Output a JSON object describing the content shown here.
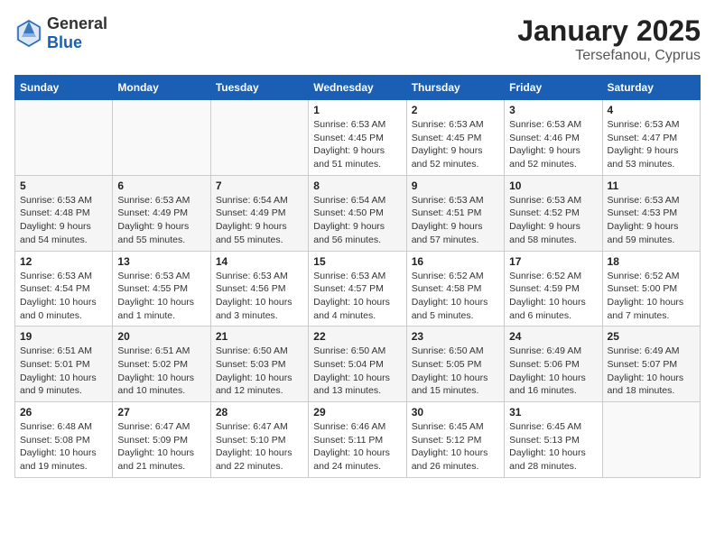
{
  "logo": {
    "general": "General",
    "blue": "Blue"
  },
  "title": "January 2025",
  "subtitle": "Tersefanou, Cyprus",
  "headers": [
    "Sunday",
    "Monday",
    "Tuesday",
    "Wednesday",
    "Thursday",
    "Friday",
    "Saturday"
  ],
  "weeks": [
    [
      {
        "day": "",
        "info": ""
      },
      {
        "day": "",
        "info": ""
      },
      {
        "day": "",
        "info": ""
      },
      {
        "day": "1",
        "info": "Sunrise: 6:53 AM\nSunset: 4:45 PM\nDaylight: 9 hours\nand 51 minutes."
      },
      {
        "day": "2",
        "info": "Sunrise: 6:53 AM\nSunset: 4:45 PM\nDaylight: 9 hours\nand 52 minutes."
      },
      {
        "day": "3",
        "info": "Sunrise: 6:53 AM\nSunset: 4:46 PM\nDaylight: 9 hours\nand 52 minutes."
      },
      {
        "day": "4",
        "info": "Sunrise: 6:53 AM\nSunset: 4:47 PM\nDaylight: 9 hours\nand 53 minutes."
      }
    ],
    [
      {
        "day": "5",
        "info": "Sunrise: 6:53 AM\nSunset: 4:48 PM\nDaylight: 9 hours\nand 54 minutes."
      },
      {
        "day": "6",
        "info": "Sunrise: 6:53 AM\nSunset: 4:49 PM\nDaylight: 9 hours\nand 55 minutes."
      },
      {
        "day": "7",
        "info": "Sunrise: 6:54 AM\nSunset: 4:49 PM\nDaylight: 9 hours\nand 55 minutes."
      },
      {
        "day": "8",
        "info": "Sunrise: 6:54 AM\nSunset: 4:50 PM\nDaylight: 9 hours\nand 56 minutes."
      },
      {
        "day": "9",
        "info": "Sunrise: 6:53 AM\nSunset: 4:51 PM\nDaylight: 9 hours\nand 57 minutes."
      },
      {
        "day": "10",
        "info": "Sunrise: 6:53 AM\nSunset: 4:52 PM\nDaylight: 9 hours\nand 58 minutes."
      },
      {
        "day": "11",
        "info": "Sunrise: 6:53 AM\nSunset: 4:53 PM\nDaylight: 9 hours\nand 59 minutes."
      }
    ],
    [
      {
        "day": "12",
        "info": "Sunrise: 6:53 AM\nSunset: 4:54 PM\nDaylight: 10 hours\nand 0 minutes."
      },
      {
        "day": "13",
        "info": "Sunrise: 6:53 AM\nSunset: 4:55 PM\nDaylight: 10 hours\nand 1 minute."
      },
      {
        "day": "14",
        "info": "Sunrise: 6:53 AM\nSunset: 4:56 PM\nDaylight: 10 hours\nand 3 minutes."
      },
      {
        "day": "15",
        "info": "Sunrise: 6:53 AM\nSunset: 4:57 PM\nDaylight: 10 hours\nand 4 minutes."
      },
      {
        "day": "16",
        "info": "Sunrise: 6:52 AM\nSunset: 4:58 PM\nDaylight: 10 hours\nand 5 minutes."
      },
      {
        "day": "17",
        "info": "Sunrise: 6:52 AM\nSunset: 4:59 PM\nDaylight: 10 hours\nand 6 minutes."
      },
      {
        "day": "18",
        "info": "Sunrise: 6:52 AM\nSunset: 5:00 PM\nDaylight: 10 hours\nand 7 minutes."
      }
    ],
    [
      {
        "day": "19",
        "info": "Sunrise: 6:51 AM\nSunset: 5:01 PM\nDaylight: 10 hours\nand 9 minutes."
      },
      {
        "day": "20",
        "info": "Sunrise: 6:51 AM\nSunset: 5:02 PM\nDaylight: 10 hours\nand 10 minutes."
      },
      {
        "day": "21",
        "info": "Sunrise: 6:50 AM\nSunset: 5:03 PM\nDaylight: 10 hours\nand 12 minutes."
      },
      {
        "day": "22",
        "info": "Sunrise: 6:50 AM\nSunset: 5:04 PM\nDaylight: 10 hours\nand 13 minutes."
      },
      {
        "day": "23",
        "info": "Sunrise: 6:50 AM\nSunset: 5:05 PM\nDaylight: 10 hours\nand 15 minutes."
      },
      {
        "day": "24",
        "info": "Sunrise: 6:49 AM\nSunset: 5:06 PM\nDaylight: 10 hours\nand 16 minutes."
      },
      {
        "day": "25",
        "info": "Sunrise: 6:49 AM\nSunset: 5:07 PM\nDaylight: 10 hours\nand 18 minutes."
      }
    ],
    [
      {
        "day": "26",
        "info": "Sunrise: 6:48 AM\nSunset: 5:08 PM\nDaylight: 10 hours\nand 19 minutes."
      },
      {
        "day": "27",
        "info": "Sunrise: 6:47 AM\nSunset: 5:09 PM\nDaylight: 10 hours\nand 21 minutes."
      },
      {
        "day": "28",
        "info": "Sunrise: 6:47 AM\nSunset: 5:10 PM\nDaylight: 10 hours\nand 22 minutes."
      },
      {
        "day": "29",
        "info": "Sunrise: 6:46 AM\nSunset: 5:11 PM\nDaylight: 10 hours\nand 24 minutes."
      },
      {
        "day": "30",
        "info": "Sunrise: 6:45 AM\nSunset: 5:12 PM\nDaylight: 10 hours\nand 26 minutes."
      },
      {
        "day": "31",
        "info": "Sunrise: 6:45 AM\nSunset: 5:13 PM\nDaylight: 10 hours\nand 28 minutes."
      },
      {
        "day": "",
        "info": ""
      }
    ]
  ]
}
